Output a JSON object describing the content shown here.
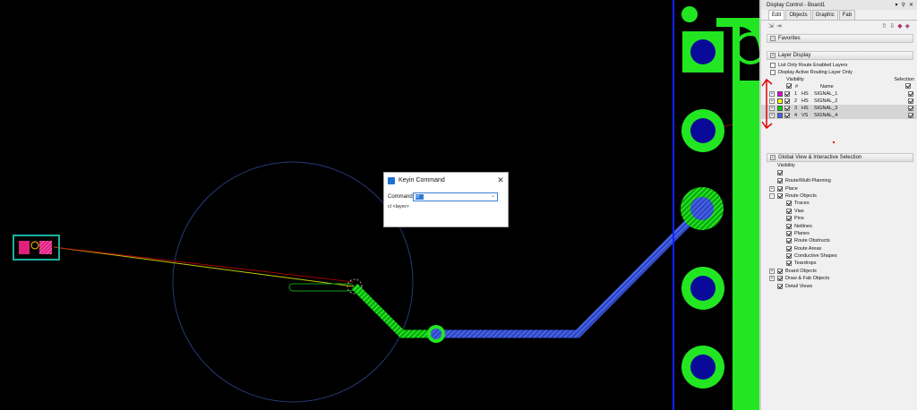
{
  "keyin": {
    "title": "Keyin Command",
    "command_label": "Command:",
    "command_value": "cl",
    "hint": "cl <layer>"
  },
  "panel": {
    "title": "Display Control - Board1",
    "tabs": [
      "Edit",
      "Objects",
      "Graphic",
      "Fab"
    ],
    "favorites": "Favorites",
    "layer_display": "Layer Display",
    "opt_route_enabled": "List Only Route Enabled Layers",
    "opt_active_routing": "Display Active Routing Layer Only",
    "visibility": "Visibility",
    "selection": "Selection",
    "hash": "#",
    "name": "Name",
    "layers": [
      {
        "num": "1",
        "type": "HS",
        "name": "SIGNAL_1",
        "color": "#e000e0"
      },
      {
        "num": "2",
        "type": "HS",
        "name": "SIGNAL_2",
        "color": "#ffff00"
      },
      {
        "num": "3",
        "type": "HS",
        "name": "SIGNAL_3",
        "color": "#00d000"
      },
      {
        "num": "4",
        "type": "VS",
        "name": "SIGNAL_4",
        "color": "#4060ff"
      }
    ],
    "global_view": "Global View & Interactive Selection",
    "global_visibility": "Visibility",
    "tree": [
      {
        "label": "Route/Multi Planning",
        "level": 0,
        "exp": ""
      },
      {
        "label": "Place",
        "level": 0,
        "exp": "+"
      },
      {
        "label": "Route Objects",
        "level": 0,
        "exp": "-"
      },
      {
        "label": "Traces",
        "level": 1,
        "exp": ""
      },
      {
        "label": "Vias",
        "level": 1,
        "exp": ""
      },
      {
        "label": "Pins",
        "level": 1,
        "exp": ""
      },
      {
        "label": "Netlines",
        "level": 1,
        "exp": ""
      },
      {
        "label": "Planes",
        "level": 1,
        "exp": ""
      },
      {
        "label": "Route Obstructs",
        "level": 1,
        "exp": ""
      },
      {
        "label": "Route Areas",
        "level": 1,
        "exp": ""
      },
      {
        "label": "Conductive Shapes",
        "level": 1,
        "exp": ""
      },
      {
        "label": "Teardrops",
        "level": 1,
        "exp": ""
      },
      {
        "label": "Board Objects",
        "level": 0,
        "exp": "+"
      },
      {
        "label": "Draw & Fab Objects",
        "level": 0,
        "exp": "+"
      },
      {
        "label": "Detail Views",
        "level": 0,
        "exp": ""
      }
    ]
  },
  "colors": {
    "pad": "#22e622",
    "hole": "#0a0a9a",
    "trace_blue": "#3c56d8",
    "board_edge": "#1020ff",
    "annotation": "#e00000"
  }
}
